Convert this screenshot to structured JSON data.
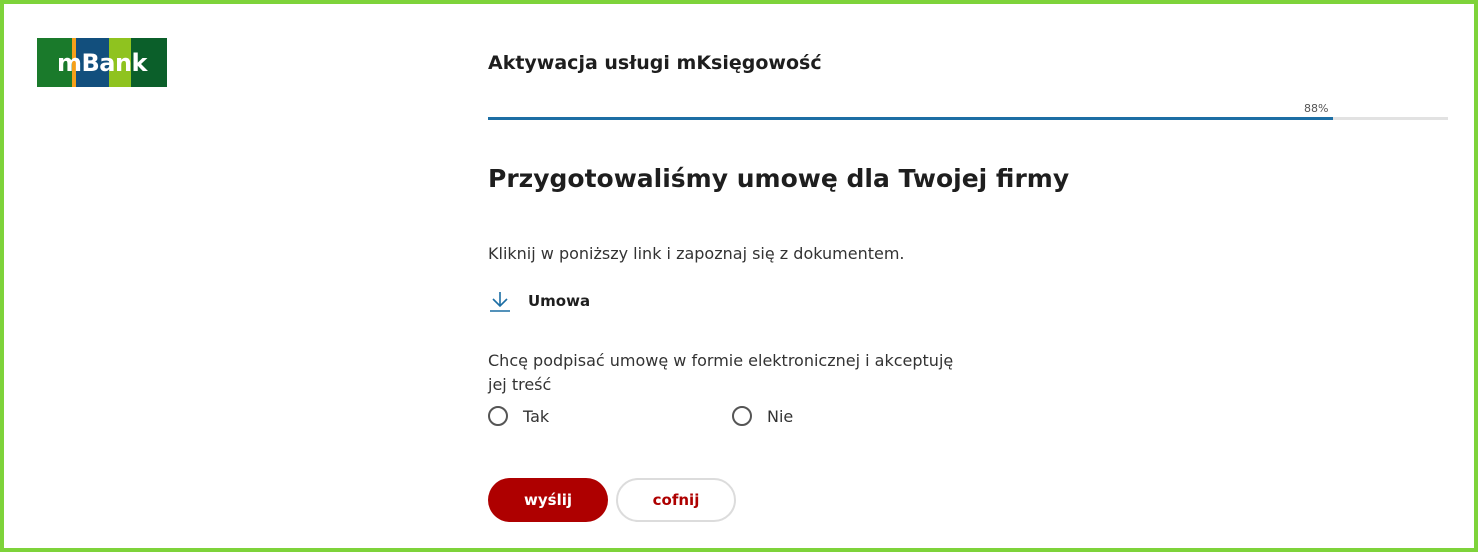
{
  "brand": {
    "logo_text": "mBank",
    "stripe_colors": [
      "#1a7a2b",
      "#f5a01a",
      "#124f7d",
      "#8fc31f",
      "#0b5f2a"
    ]
  },
  "header": {
    "title": "Aktywacja usługi mKsięgowość"
  },
  "progress": {
    "label": "88%",
    "value": 0.88,
    "color": "#1c6ea4"
  },
  "main": {
    "title": "Przygotowaliśmy umowę dla Twojej firmy",
    "instruction": "Kliknij w poniższy link i zapoznaj się z dokumentem.",
    "document_link": {
      "label": "Umowa",
      "icon": "download-icon"
    },
    "consent_text": "Chcę podpisać umowę w formie elektronicznej i akceptuję jej treść",
    "options": [
      {
        "label": "Tak",
        "selected": false
      },
      {
        "label": "Nie",
        "selected": false
      }
    ]
  },
  "actions": {
    "submit_label": "wyślij",
    "back_label": "cofnij"
  },
  "colors": {
    "accent_red": "#ae0000",
    "frame_green": "#7ed33a",
    "link_blue": "#1c6ea4"
  }
}
